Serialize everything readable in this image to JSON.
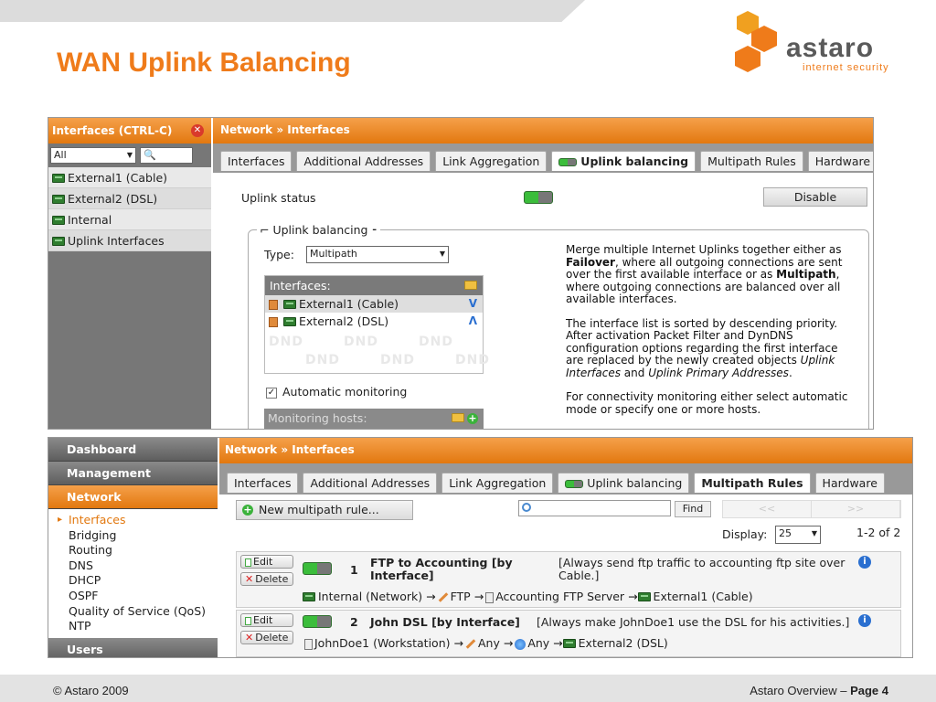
{
  "slide": {
    "title": "WAN Uplink Balancing",
    "logo_text": "astaro",
    "logo_tagline": "internet security",
    "footer_left": "© Astaro 2009",
    "footer_right_prefix": "Astaro Overview – ",
    "footer_right_page": "Page 4"
  },
  "colors": {
    "accent": "#ef7b1a",
    "nav_gray": "#777777"
  },
  "panel1": {
    "sidebar": {
      "title": "Interfaces (CTRL-C)",
      "filter_value": "All",
      "items": [
        "External1 (Cable)",
        "External2 (DSL)",
        "Internal",
        "Uplink Interfaces"
      ]
    },
    "breadcrumb": "Network » Interfaces",
    "tabs": [
      "Interfaces",
      "Additional Addresses",
      "Link Aggregation",
      "Uplink balancing",
      "Multipath Rules",
      "Hardware"
    ],
    "active_tab": "Uplink balancing",
    "uplink_status_label": "Uplink status",
    "disable_label": "Disable",
    "section_legend": "Uplink balancing",
    "type_label": "Type:",
    "type_value": "Multipath",
    "interfaces_header": "Interfaces:",
    "interfaces": [
      {
        "name": "External1 (Cable)",
        "priority_icon": "chevron-down-icon"
      },
      {
        "name": "External2 (DSL)",
        "priority_icon": "chevron-up-icon"
      }
    ],
    "dnd_label": "DND",
    "auto_monitoring_label": "Automatic monitoring",
    "auto_monitoring_checked": true,
    "monitoring_hosts_header": "Monitoring hosts:",
    "help": {
      "p1_a": "Merge multiple Internet Uplinks together either as ",
      "p1_b": "Failover",
      "p1_c": ", where all outgoing connections are sent over the first available interface or as ",
      "p1_d": "Multipath",
      "p1_e": ", where outgoing connections are balanced over all available interfaces.",
      "p2_a": "The interface list is sorted by descending priority. After activation Packet Filter and DynDNS configuration options regarding the first interface are replaced by the newly created objects ",
      "p2_b": "Uplink Interfaces",
      "p2_c": " and ",
      "p2_d": "Uplink Primary Addresses",
      "p2_e": ".",
      "p3": "For connectivity monitoring either select automatic mode or specify one or more hosts."
    }
  },
  "panel2": {
    "nav": {
      "dashboard": "Dashboard",
      "management": "Management",
      "network": "Network",
      "subitems": [
        "Interfaces",
        "Bridging",
        "Routing",
        "DNS",
        "DHCP",
        "OSPF",
        "Quality of Service (QoS)",
        "NTP"
      ],
      "selected_subitem": "Interfaces",
      "users": "Users"
    },
    "breadcrumb": "Network » Interfaces",
    "tabs": [
      "Interfaces",
      "Additional Addresses",
      "Link Aggregation",
      "Uplink balancing",
      "Multipath Rules",
      "Hardware"
    ],
    "active_tab": "Multipath Rules",
    "new_rule_label": "New multipath rule...",
    "find_label": "Find",
    "pager_prev": "<<",
    "pager_next": ">>",
    "display_label": "Display:",
    "display_value": "25",
    "count_label": "1-2 of 2",
    "edit_label": "Edit",
    "delete_label": "Delete",
    "rules": [
      {
        "num": "1",
        "name": "FTP to Accounting [by Interface]",
        "comment": "[Always send ftp traffic to accounting ftp site over Cable.]",
        "src": "Internal (Network)",
        "service": "FTP",
        "dst": "Accounting FTP Server",
        "iface": "External1 (Cable)"
      },
      {
        "num": "2",
        "name": "John DSL [by Interface]",
        "comment": "[Always make JohnDoe1 use the DSL for his activities.]",
        "src": "JohnDoe1 (Workstation)",
        "service": "Any",
        "dst": "Any",
        "iface": "External2 (DSL)"
      }
    ],
    "arrow": "→"
  }
}
